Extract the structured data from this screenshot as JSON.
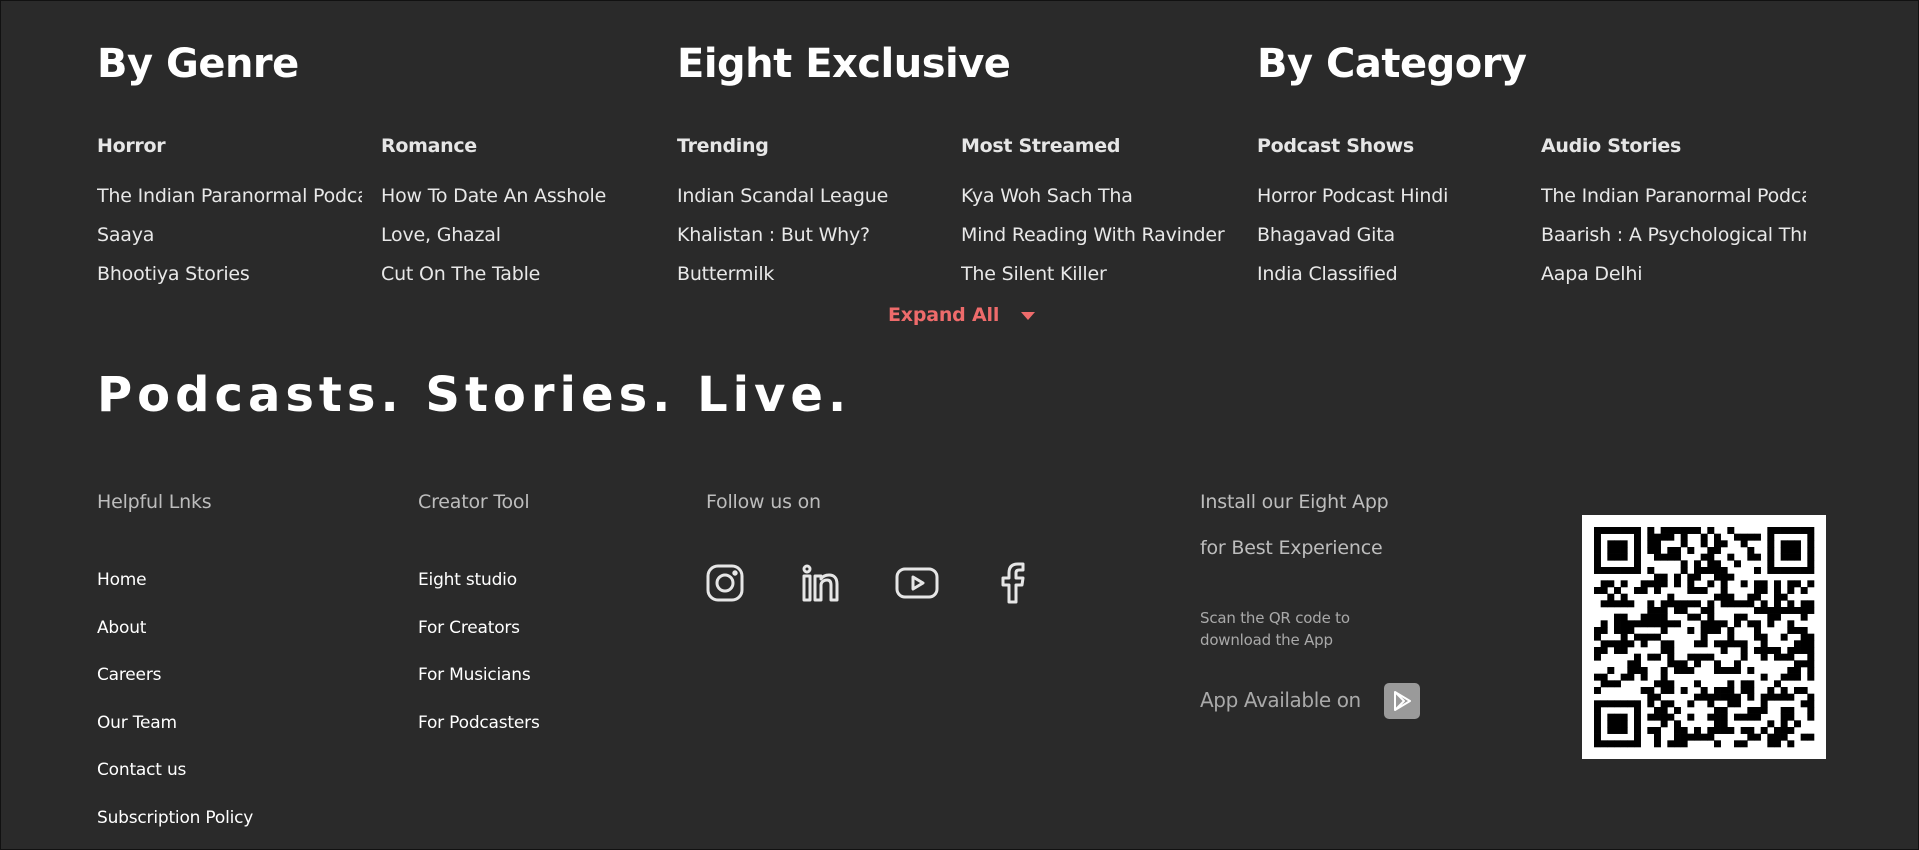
{
  "genre": {
    "title": "By Genre",
    "columns": [
      {
        "heading": "Horror",
        "items": [
          "The Indian Paranormal Podcast",
          "Saaya",
          "Bhootiya Stories"
        ]
      },
      {
        "heading": "Romance",
        "items": [
          "How To Date An Asshole",
          "Love, Ghazal",
          "Cut On The Table"
        ]
      }
    ]
  },
  "exclusive": {
    "title": "Eight Exclusive",
    "columns": [
      {
        "heading": "Trending",
        "items": [
          "Indian Scandal League",
          "Khalistan : But Why?",
          "Buttermilk"
        ]
      },
      {
        "heading": "Most Streamed",
        "items": [
          "Kya Woh Sach Tha",
          "Mind Reading With Ravinder",
          "The Silent Killer"
        ]
      }
    ]
  },
  "category": {
    "title": "By Category",
    "columns": [
      {
        "heading": "Podcast Shows",
        "items": [
          "Horror Podcast Hindi",
          "Bhagavad Gita",
          "India Classified"
        ]
      },
      {
        "heading": "Audio Stories",
        "items": [
          "The Indian Paranormal Podcast",
          "Baarish : A Psychological Thriller",
          "Aapa Delhi"
        ]
      }
    ]
  },
  "expand": {
    "label": "Expand All"
  },
  "tagline": "Podcasts. Stories. Live.",
  "footer": {
    "helpful": {
      "heading": "Helpful Lnks",
      "links": [
        "Home",
        "About",
        "Careers",
        "Our Team",
        "Contact us",
        "Subscription Policy"
      ]
    },
    "creator": {
      "heading": "Creator Tool",
      "links": [
        "Eight studio",
        "For Creators",
        "For Musicians",
        "For Podcasters"
      ]
    },
    "follow": {
      "heading": "Follow us on",
      "icons": [
        "instagram-icon",
        "linkedin-icon",
        "youtube-icon",
        "facebook-icon"
      ]
    },
    "install": {
      "line1": "Install our Eight App",
      "line2": "for Best Experience",
      "scan": "Scan the QR code to download the App",
      "available": "App Available on",
      "store_icon": "google-play-icon"
    }
  },
  "colors": {
    "background": "#2a2a2a",
    "accent": "#ee6b6b"
  }
}
